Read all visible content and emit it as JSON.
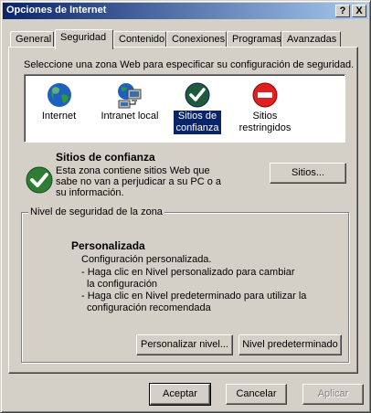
{
  "window": {
    "title": "Opciones de Internet",
    "help_button": "?",
    "close_button": "X"
  },
  "tabs": [
    {
      "label": "General",
      "active": false
    },
    {
      "label": "Seguridad",
      "active": true
    },
    {
      "label": "Contenido",
      "active": false
    },
    {
      "label": "Conexiones",
      "active": false
    },
    {
      "label": "Programas",
      "active": false
    },
    {
      "label": "Avanzadas",
      "active": false
    }
  ],
  "security": {
    "instruction": "Seleccione una zona Web para especificar su configuración de seguridad.",
    "zones": [
      {
        "label_lines": [
          "Internet"
        ],
        "icon": "globe-icon",
        "selected": false
      },
      {
        "label_lines": [
          "Intranet local"
        ],
        "icon": "local-intranet-icon",
        "selected": false
      },
      {
        "label_lines": [
          "Sitios de",
          "confianza"
        ],
        "icon": "trusted-sites-check-icon",
        "selected": true
      },
      {
        "label_lines": [
          "Sitios",
          "restringidos"
        ],
        "icon": "restricted-sites-icon",
        "selected": false
      }
    ],
    "selected_zone": {
      "name": "Sitios de confianza",
      "description_lines": [
        "Esta zona contiene sitios Web que",
        "sabe no van a perjudicar a su PC o a",
        "su información."
      ],
      "sites_button": "Sitios..."
    },
    "level_group": {
      "legend": "Nivel de seguridad de la zona",
      "title": "Personalizada",
      "lines": [
        "Configuración personalizada.",
        "- Haga clic en Nivel personalizado para cambiar",
        "  la configuración",
        "- Haga clic en Nivel predeterminado para utilizar la",
        "  configuración recomendada"
      ],
      "custom_level_button": "Personalizar nivel...",
      "default_level_button": "Nivel predeterminado"
    }
  },
  "footer": {
    "ok": "Aceptar",
    "cancel": "Cancelar",
    "apply": "Aplicar"
  },
  "colors": {
    "title_bar_start": "#0a246a",
    "title_bar_end": "#a6caf0",
    "face": "#d4d0c8",
    "selection": "#0a246a",
    "trusted_green": "#2e7d32",
    "restricted_red": "#e02020"
  }
}
